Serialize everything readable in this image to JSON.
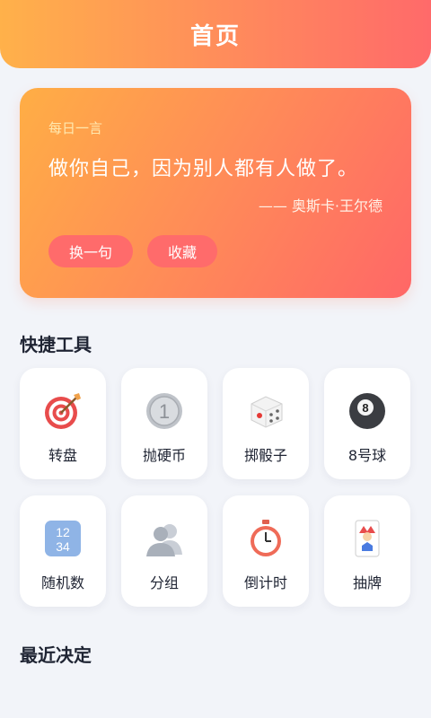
{
  "header": {
    "title": "首页"
  },
  "quote_card": {
    "label": "每日一言",
    "text": "做你自己，因为别人都有人做了。",
    "author": "—— 奥斯卡·王尔德",
    "change_button": "换一句",
    "favorite_button": "收藏"
  },
  "tools_section": {
    "title": "快捷工具",
    "items": [
      {
        "label": "转盘",
        "icon": "dartboard-icon"
      },
      {
        "label": "抛硬币",
        "icon": "coin-icon"
      },
      {
        "label": "掷骰子",
        "icon": "dice-icon"
      },
      {
        "label": "8号球",
        "icon": "eight-ball-icon"
      },
      {
        "label": "随机数",
        "icon": "number-tiles-icon"
      },
      {
        "label": "分组",
        "icon": "group-people-icon"
      },
      {
        "label": "倒计时",
        "icon": "stopwatch-icon"
      },
      {
        "label": "抽牌",
        "icon": "joker-card-icon"
      }
    ]
  },
  "recent_section": {
    "title": "最近决定"
  },
  "icon_text": {
    "random_numbers": "12 34",
    "coin_value": "1",
    "ball_number": "8"
  }
}
